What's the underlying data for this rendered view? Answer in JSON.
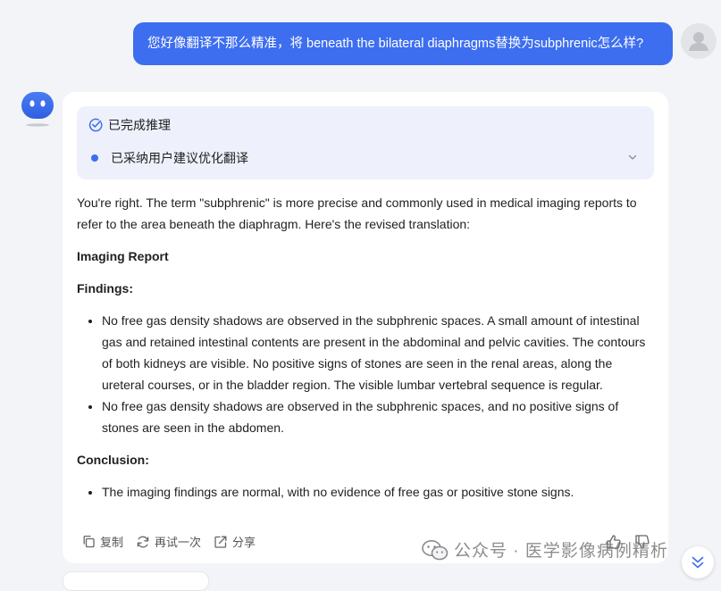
{
  "user_message": "您好像翻译不那么精准，将 beneath the bilateral diaphragms替换为subphrenic怎么样?",
  "reasoning": {
    "title": "已完成推理",
    "step": "已采纳用户建议优化翻译"
  },
  "response": {
    "intro": "You're right. The term \"subphrenic\" is more precise and commonly used in medical imaging reports to refer to the area beneath the diaphragm. Here's the revised translation:",
    "report_title": "Imaging Report",
    "findings_heading": "Findings:",
    "findings": [
      "No free gas density shadows are observed in the subphrenic spaces. A small amount of intestinal gas and retained intestinal contents are present in the abdominal and pelvic cavities. The contours of both kidneys are visible. No positive signs of stones are seen in the renal areas, along the ureteral courses, or in the bladder region. The visible lumbar vertebral sequence is regular.",
      "No free gas density shadows are observed in the subphrenic spaces, and no positive signs of stones are seen in the abdomen."
    ],
    "conclusion_heading": "Conclusion:",
    "conclusion": [
      "The imaging findings are normal, with no evidence of free gas or positive stone signs."
    ]
  },
  "actions": {
    "copy": "复制",
    "retry": "再试一次",
    "share": "分享"
  },
  "watermark": "公众号 · 医学影像病例精析",
  "colors": {
    "accent": "#3d6ef0",
    "page_bg": "#f3f4f7",
    "reason_bg": "#eef1fb"
  }
}
